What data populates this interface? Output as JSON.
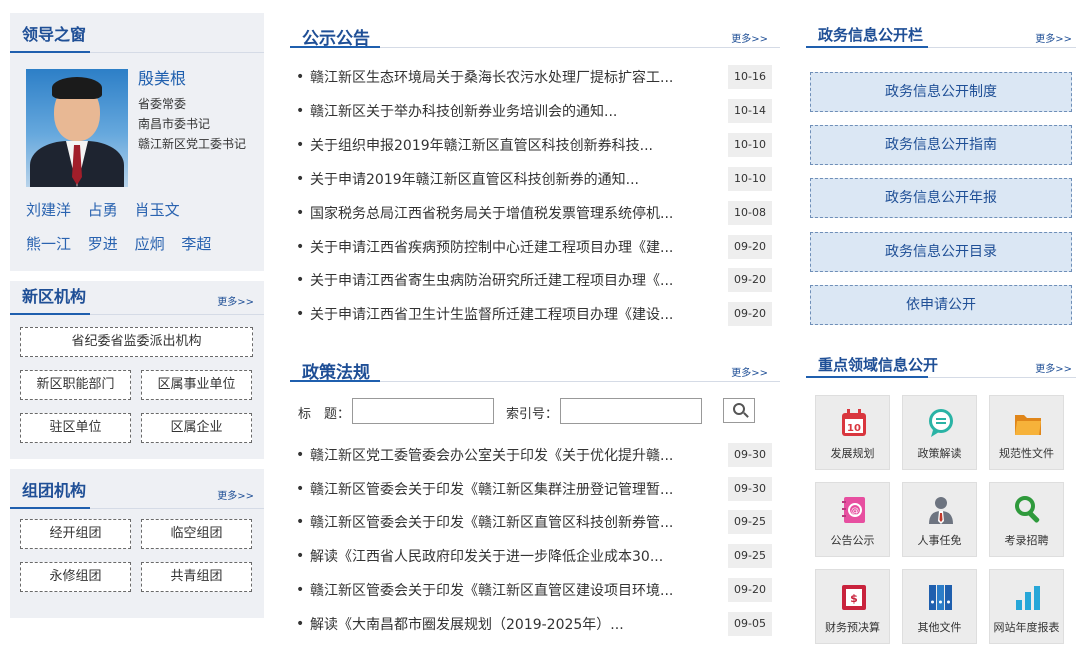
{
  "leaders": {
    "title": "领导之窗",
    "name": "殷美根",
    "titles": [
      "省委常委",
      "南昌市委书记",
      "赣江新区党工委书记"
    ],
    "others_row1": [
      "刘建洋",
      "占勇",
      "肖玉文"
    ],
    "others_row2": [
      "熊一江",
      "罗进",
      "应炯",
      "李超"
    ]
  },
  "xinqu": {
    "title": "新区机构",
    "more": "更多>>",
    "items": [
      "省纪委省监委派出机构",
      "新区职能部门",
      "区属事业单位",
      "驻区单位",
      "区属企业"
    ]
  },
  "zutuan": {
    "title": "组团机构",
    "more": "更多>>",
    "items": [
      "经开组团",
      "临空组团",
      "永修组团",
      "共青组团"
    ]
  },
  "notices": {
    "title": "公示公告",
    "more": "更多>>",
    "items": [
      {
        "title": "赣江新区生态环境局关于桑海长农污水处理厂提标扩容工...",
        "date": "10-16"
      },
      {
        "title": "赣江新区关于举办科技创新券业务培训会的通知...",
        "date": "10-14"
      },
      {
        "title": "关于组织申报2019年赣江新区直管区科技创新券科技...",
        "date": "10-10"
      },
      {
        "title": "关于申请2019年赣江新区直管区科技创新券的通知...",
        "date": "10-10"
      },
      {
        "title": "国家税务总局江西省税务局关于增值税发票管理系统停机...",
        "date": "10-08"
      },
      {
        "title": "关于申请江西省疾病预防控制中心迁建工程项目办理《建...",
        "date": "09-20"
      },
      {
        "title": "关于申请江西省寄生虫病防治研究所迁建工程项目办理《...",
        "date": "09-20"
      },
      {
        "title": "关于申请江西省卫生计生监督所迁建工程项目办理《建设...",
        "date": "09-20"
      }
    ]
  },
  "policy": {
    "title": "政策法规",
    "more": "更多>>",
    "search_title_label": "标　题：",
    "search_index_label": "索引号：",
    "search_title_value": "",
    "search_index_value": "",
    "items": [
      {
        "title": "赣江新区党工委管委会办公室关于印发《关于优化提升赣...",
        "date": "09-30"
      },
      {
        "title": "赣江新区管委会关于印发《赣江新区集群注册登记管理暂...",
        "date": "09-30"
      },
      {
        "title": "赣江新区管委会关于印发《赣江新区直管区科技创新券管...",
        "date": "09-25"
      },
      {
        "title": "解读《江西省人民政府印发关于进一步降低企业成本30...",
        "date": "09-25"
      },
      {
        "title": "赣江新区管委会关于印发《赣江新区直管区建设项目环境...",
        "date": "09-20"
      },
      {
        "title": "解读《大南昌都市圈发展规划（2019-2025年）...",
        "date": "09-05"
      }
    ]
  },
  "gov": {
    "title": "政务信息公开栏",
    "more": "更多>>",
    "items": [
      "政务信息公开制度",
      "政务信息公开指南",
      "政务信息公开年报",
      "政务信息公开目录",
      "依申请公开"
    ]
  },
  "key": {
    "title": "重点领域信息公开",
    "more": "更多>>",
    "items": [
      {
        "label": "发展规划",
        "icon": "calendar-icon"
      },
      {
        "label": "政策解读",
        "icon": "speech-bubble-icon"
      },
      {
        "label": "规范性文件",
        "icon": "folder-icon"
      },
      {
        "label": "公告公示",
        "icon": "notebook-icon"
      },
      {
        "label": "人事任免",
        "icon": "person-tie-icon"
      },
      {
        "label": "考录招聘",
        "icon": "magnifier-icon"
      },
      {
        "label": "财务预决算",
        "icon": "finance-document-icon"
      },
      {
        "label": "其他文件",
        "icon": "binders-icon"
      },
      {
        "label": "网站年度报表",
        "icon": "bar-chart-icon"
      }
    ],
    "colors": {
      "red": "#d9363e",
      "teal": "#2ab3a5",
      "orange": "#f29b1b",
      "pink": "#e74fa0",
      "grey": "#6d7480",
      "green": "#2f9a3c",
      "blue": "#2c7dc8",
      "cyan": "#27a7d8"
    }
  }
}
